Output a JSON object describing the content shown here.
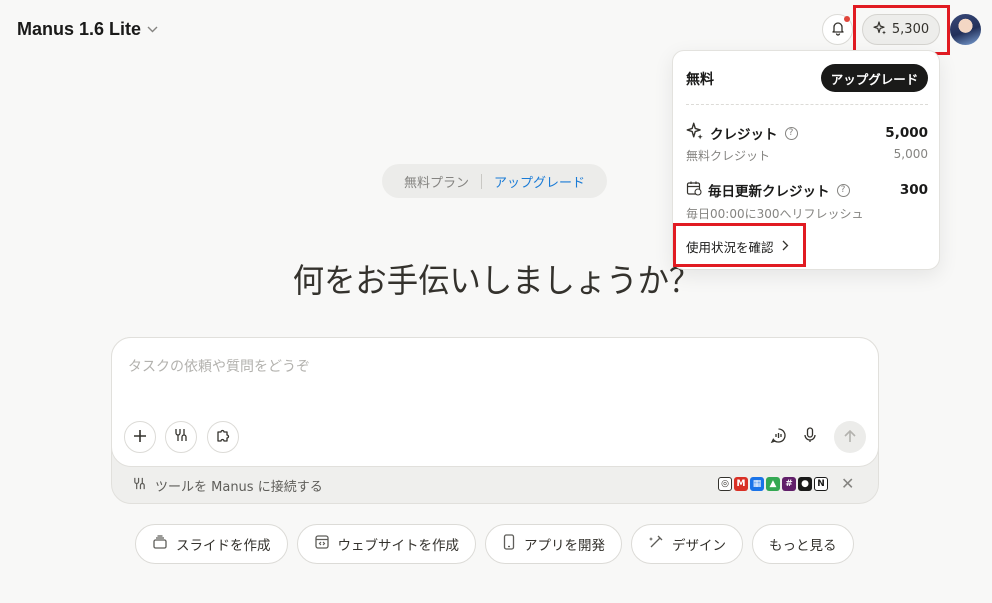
{
  "header": {
    "app_title": "Manus 1.6 Lite",
    "credits": "5,300"
  },
  "plan_banner": {
    "plan": "無料プラン",
    "upgrade": "アップグレード"
  },
  "headline": "何をお手伝いしましょうか？",
  "composer": {
    "placeholder": "タスクの依頼や質問をどうぞ",
    "connect_text": "ツールを Manus に接続する"
  },
  "quick_actions": [
    {
      "label": "スライドを作成",
      "icon": "slides-icon"
    },
    {
      "label": "ウェブサイトを作成",
      "icon": "website-icon"
    },
    {
      "label": "アプリを開発",
      "icon": "mobile-icon"
    },
    {
      "label": "デザイン",
      "icon": "design-icon"
    },
    {
      "label": "もっと見る",
      "icon": ""
    }
  ],
  "credit_menu": {
    "plan": "無料",
    "upgrade_button": "アップグレード",
    "credits_label": "クレジット",
    "credits_value": "5,000",
    "free_credits_label": "無料クレジット",
    "free_credits_value": "5,000",
    "daily_label": "毎日更新クレジット",
    "daily_value": "300",
    "daily_note": "毎日00:00に300へリフレッシュ",
    "usage_link": "使用状況を確認"
  },
  "colors": {
    "accent_link": "#1a7bd6",
    "highlight_box": "#e11b22",
    "notification_dot": "#e0453a"
  }
}
